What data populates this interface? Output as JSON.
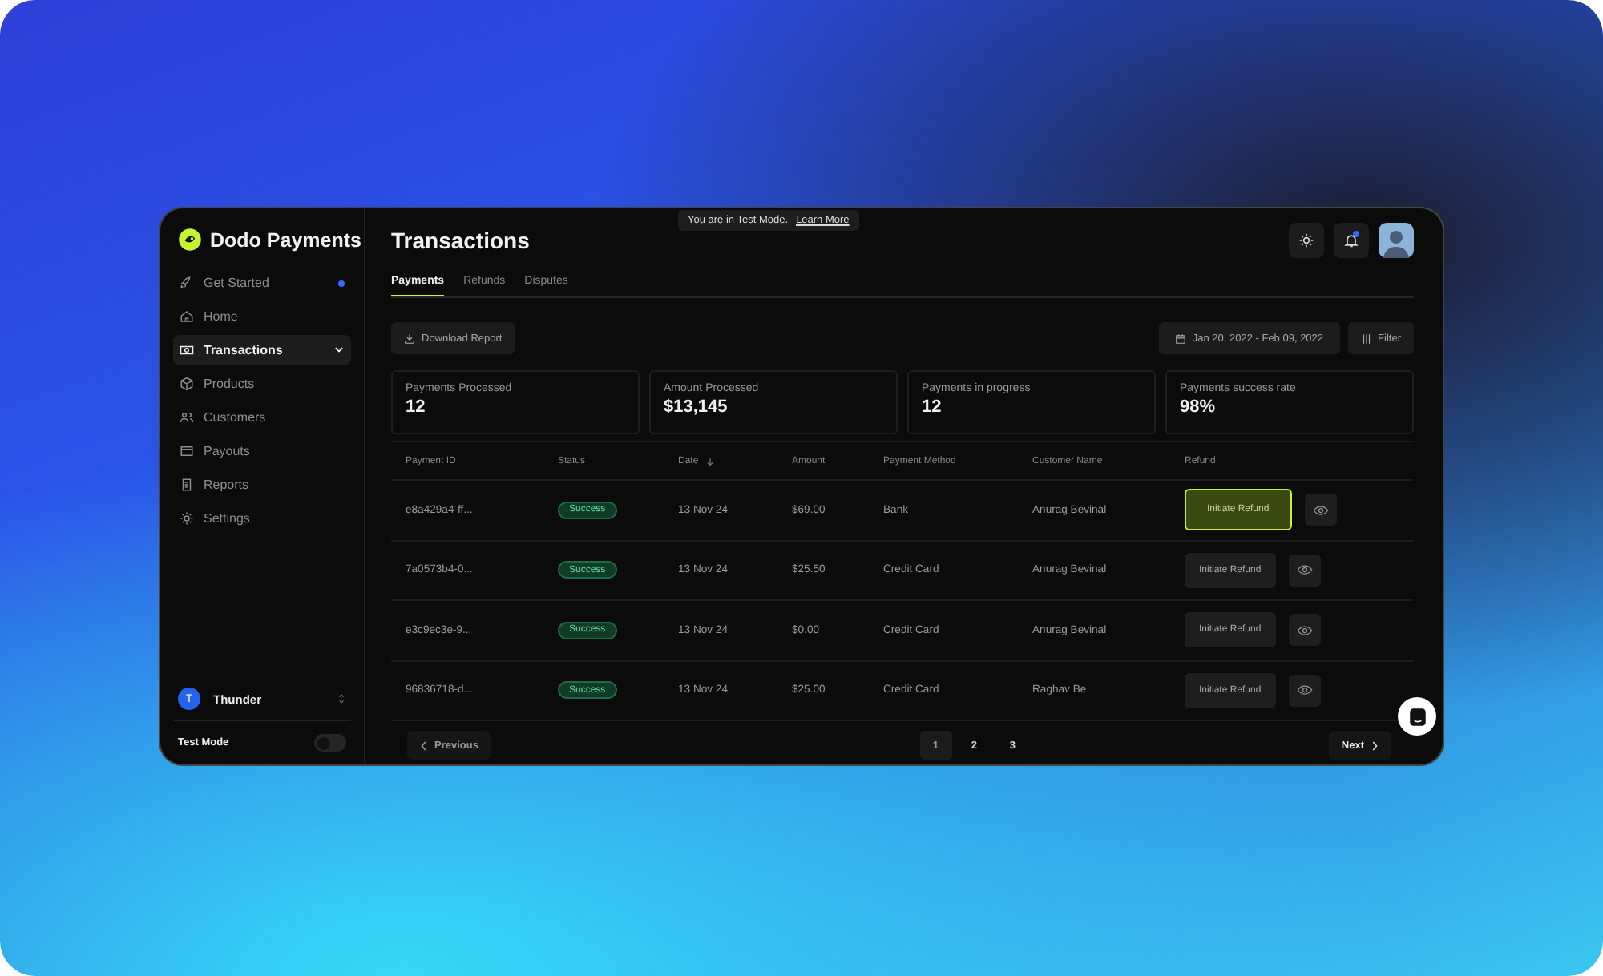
{
  "brand": {
    "name": "Dodo Payments"
  },
  "sidebar": {
    "items": [
      {
        "label": "Get Started",
        "selected": false,
        "dot": true,
        "expandable": false
      },
      {
        "label": "Home",
        "selected": false,
        "dot": false,
        "expandable": false
      },
      {
        "label": "Transactions",
        "selected": true,
        "dot": false,
        "expandable": true
      },
      {
        "label": "Products",
        "selected": false,
        "dot": false,
        "expandable": false
      },
      {
        "label": "Customers",
        "selected": false,
        "dot": false,
        "expandable": false
      },
      {
        "label": "Payouts",
        "selected": false,
        "dot": false,
        "expandable": false
      },
      {
        "label": "Reports",
        "selected": false,
        "dot": false,
        "expandable": false
      },
      {
        "label": "Settings",
        "selected": false,
        "dot": false,
        "expandable": false
      }
    ],
    "account": {
      "initial": "T",
      "name": "Thunder"
    },
    "test_mode": {
      "label": "Test Mode",
      "on": false
    }
  },
  "banner": {
    "text": "You are in Test Mode.",
    "link": "Learn More"
  },
  "header": {
    "title": "Transactions",
    "notification_dot": true
  },
  "tabs": [
    {
      "label": "Payments",
      "selected": true
    },
    {
      "label": "Refunds",
      "selected": false
    },
    {
      "label": "Disputes",
      "selected": false
    }
  ],
  "toolbar": {
    "download": "Download Report",
    "date_range": "Jan 20, 2022 - Feb 09, 2022",
    "filter": "Filter"
  },
  "stats": [
    {
      "label": "Payments Processed",
      "value": "12"
    },
    {
      "label": "Amount Processed",
      "value": "$13,145"
    },
    {
      "label": "Payments in progress",
      "value": "12"
    },
    {
      "label": "Payments success rate",
      "value": "98%"
    }
  ],
  "table": {
    "columns": [
      "Payment ID",
      "Status",
      "Date",
      "Amount",
      "Payment Method",
      "Customer Name",
      "Refund"
    ],
    "rows": [
      {
        "id": "e8a429a4-ff...",
        "status": "Success",
        "date": "13 Nov 24",
        "amount": "$69.00",
        "method": "Bank",
        "customer": "Anurag Bevinal",
        "action": "Initiate Refund",
        "selected": true
      },
      {
        "id": "7a0573b4-0...",
        "status": "Success",
        "date": "13 Nov 24",
        "amount": "$25.50",
        "method": "Credit Card",
        "customer": "Anurag Bevinal",
        "action": "Initiate Refund",
        "selected": false
      },
      {
        "id": "e3c9ec3e-9...",
        "status": "Success",
        "date": "13 Nov 24",
        "amount": "$0.00",
        "method": "Credit Card",
        "customer": "Anurag Bevinal",
        "action": "Initiate Refund",
        "selected": false
      },
      {
        "id": "96836718-d...",
        "status": "Success",
        "date": "13 Nov 24",
        "amount": "$25.00",
        "method": "Credit Card",
        "customer": "Raghav Be",
        "action": "Initiate Refund",
        "selected": false
      }
    ]
  },
  "pagination": {
    "previous": "Previous",
    "next": "Next",
    "pages": [
      {
        "label": "1",
        "selected": true
      },
      {
        "label": "2",
        "selected": false
      },
      {
        "label": "3",
        "selected": false
      }
    ]
  }
}
